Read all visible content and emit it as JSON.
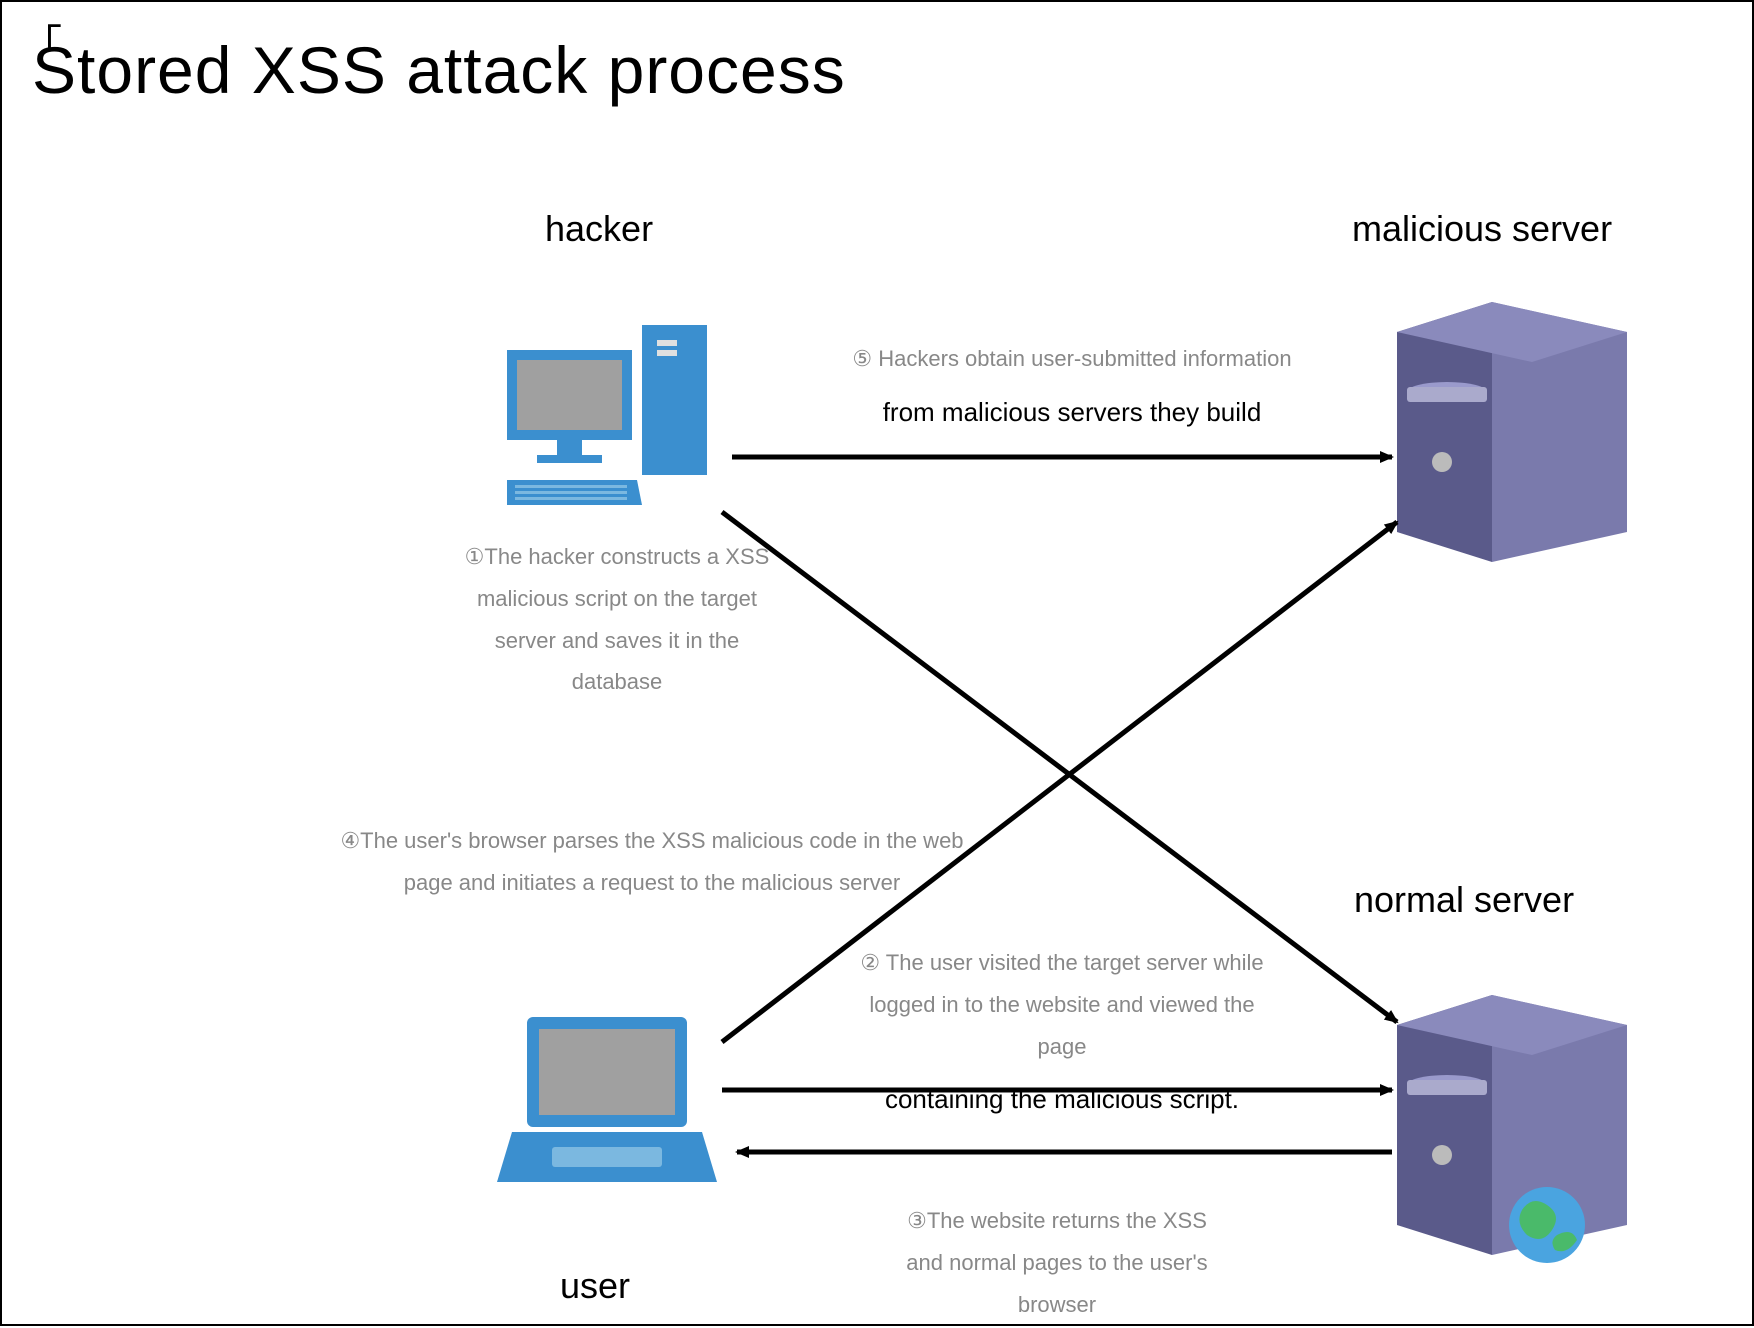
{
  "title": "Stored XSS attack process",
  "nodes": {
    "hacker": "hacker",
    "malicious_server": "malicious server",
    "normal_server": "normal server",
    "user": "user"
  },
  "steps": {
    "step1": "①The hacker constructs a XSS malicious script on the target server and saves it in the database",
    "step2_a": "② The user visited the target server while logged in to the website and viewed the page",
    "step2_b": "containing the malicious script.",
    "step3": "③The website returns the XSS and normal pages to the user's browser",
    "step4": "④The user's browser parses the XSS malicious code in the web page and initiates a request to the malicious server",
    "step5_a": "⑤ Hackers obtain user-submitted information",
    "step5_b": "from malicious servers they build"
  }
}
